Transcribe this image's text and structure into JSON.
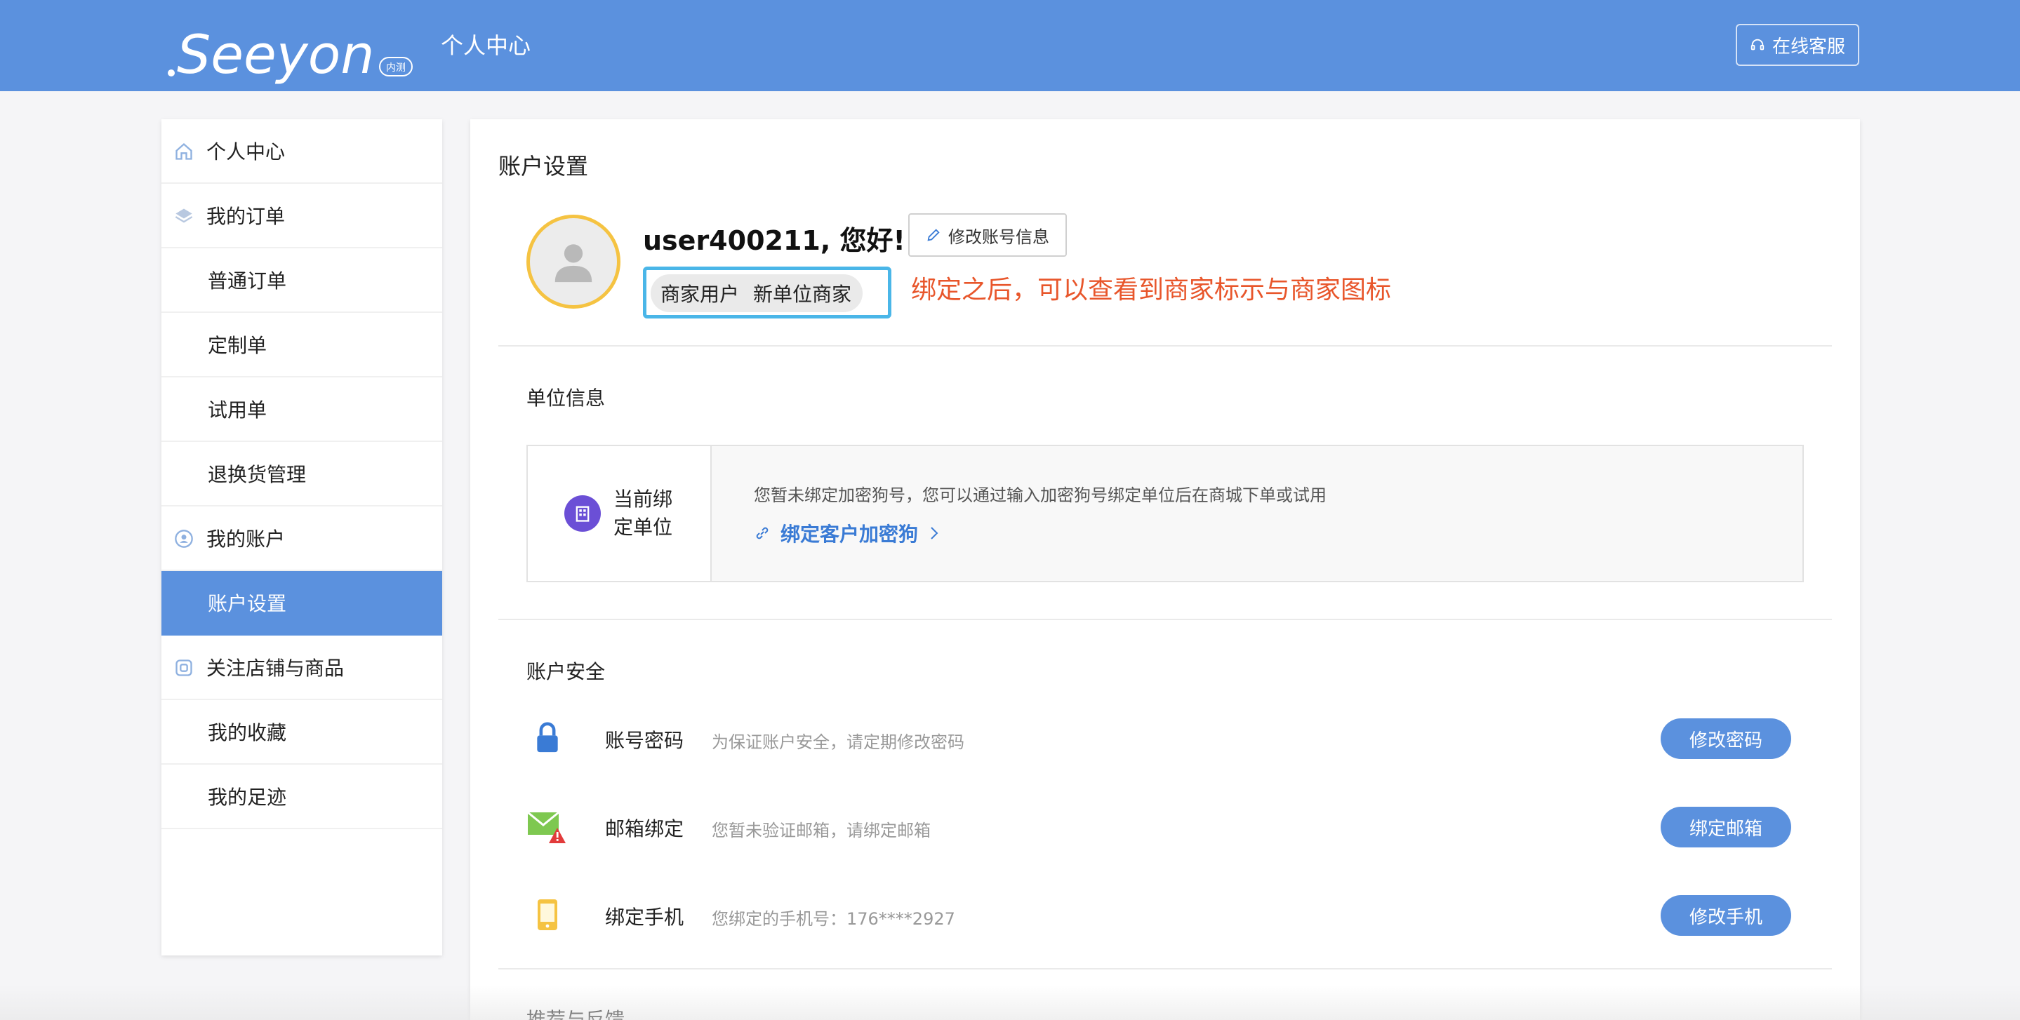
{
  "header": {
    "logo_text": "Seeyon",
    "logo_badge": "内测",
    "title": "个人中心",
    "service_button": "在线客服"
  },
  "sidebar": {
    "items": [
      {
        "label": "个人中心",
        "icon": "home-icon"
      },
      {
        "label": "我的订单",
        "icon": "layers-icon"
      },
      {
        "label": "普通订单"
      },
      {
        "label": "定制单"
      },
      {
        "label": "试用单"
      },
      {
        "label": "退换货管理"
      },
      {
        "label": "我的账户",
        "icon": "user-circle-icon"
      },
      {
        "label": "账户设置",
        "active": true
      },
      {
        "label": "关注店铺与商品",
        "icon": "store-icon"
      },
      {
        "label": "我的收藏"
      },
      {
        "label": "我的足迹"
      }
    ]
  },
  "main": {
    "title": "账户设置",
    "greeting": "user400211, 您好!",
    "edit_button": "修改账号信息",
    "badges": [
      "商家用户",
      "新单位商家"
    ],
    "annotation": "绑定之后，可以查看到商家标示与商家图标",
    "unit_section": {
      "title": "单位信息",
      "label": "当前绑定单位",
      "description": "您暂未绑定加密狗号，您可以通过输入加密狗号绑定单位后在商城下单或试用",
      "link": "绑定客户加密狗"
    },
    "security_section": {
      "title": "账户安全",
      "rows": [
        {
          "name": "账号密码",
          "desc": "为保证账户安全，请定期修改密码",
          "button": "修改密码",
          "icon": "lock-icon"
        },
        {
          "name": "邮箱绑定",
          "desc": "您暂未验证邮箱，请绑定邮箱",
          "button": "绑定邮箱",
          "icon": "mail-warning-icon"
        },
        {
          "name": "绑定手机",
          "desc": "您绑定的手机号：176****2927",
          "button": "修改手机",
          "icon": "phone-icon"
        }
      ]
    },
    "next_section_title": "推荐与反馈"
  },
  "colors": {
    "primary": "#5b91de",
    "annotation": "#e8562b",
    "avatar_border": "#f5c342",
    "highlight_border": "#4ab6e8",
    "link": "#3a7bd5"
  }
}
